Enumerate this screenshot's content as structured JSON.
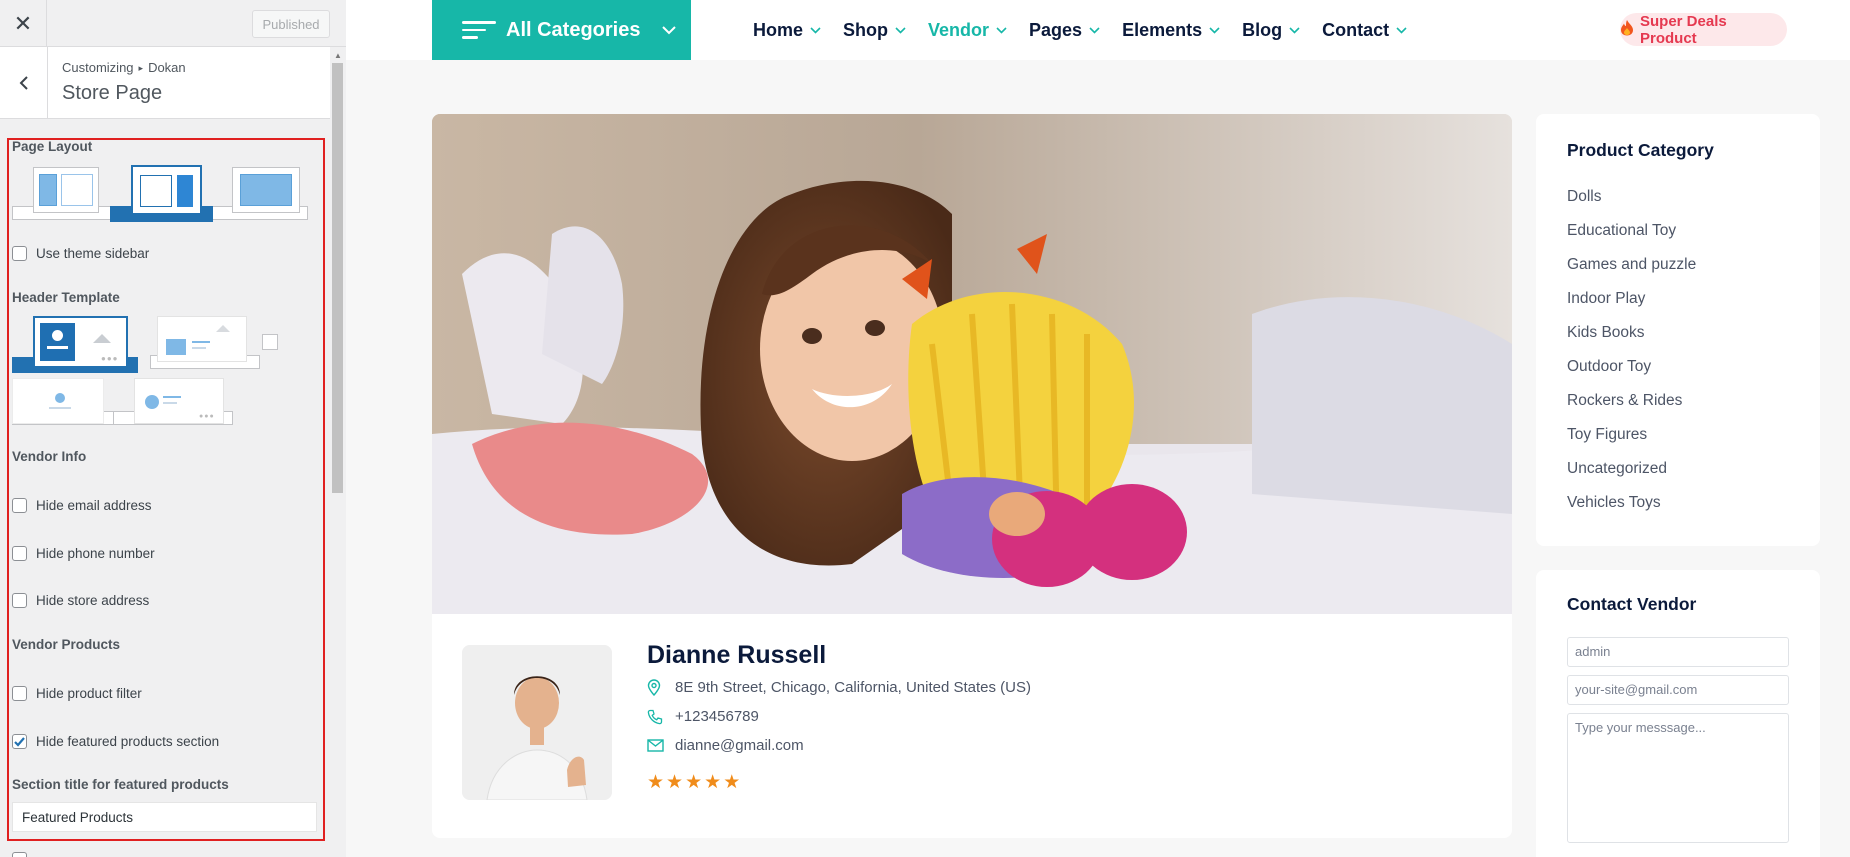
{
  "customizer": {
    "publish_label": "Published",
    "breadcrumb": [
      "Customizing",
      "Dokan"
    ],
    "breadcrumb_sep": "▸",
    "title": "Store Page",
    "page_layout_label": "Page Layout",
    "page_layout_selected": "right-sidebar",
    "use_theme_sidebar_label": "Use theme sidebar",
    "use_theme_sidebar": false,
    "header_template_label": "Header Template",
    "header_template_selected": "default",
    "vendor_info_label": "Vendor Info",
    "hide_email_label": "Hide email address",
    "hide_phone_label": "Hide phone number",
    "hide_address_label": "Hide store address",
    "vendor_products_label": "Vendor Products",
    "hide_filter_label": "Hide product filter",
    "hide_featured_label": "Hide featured products section",
    "hide_featured_checked": true,
    "featured_title_label": "Section title for featured products",
    "featured_title_value": "Featured Products",
    "highlight_color": "#e02020"
  },
  "site": {
    "all_categories": "All Categories",
    "nav": [
      "Home",
      "Shop",
      "Vendor",
      "Pages",
      "Elements",
      "Blog",
      "Contact"
    ],
    "nav_active": "Vendor",
    "deals": "Super Deals Product",
    "accent_color": "#17b7a8"
  },
  "vendor": {
    "name": "Dianne Russell",
    "address": "8E 9th Street, Chicago, California, United States (US)",
    "phone": "+123456789",
    "email": "dianne@gmail.com",
    "rating": 5
  },
  "product_category": {
    "title": "Product Category",
    "items": [
      "Dolls",
      "Educational Toy",
      "Games and puzzle",
      "Indoor Play",
      "Kids Books",
      "Outdoor Toy",
      "Rockers & Rides",
      "Toy Figures",
      "Uncategorized",
      "Vehicles Toys"
    ]
  },
  "contact_vendor": {
    "title": "Contact Vendor",
    "name_placeholder": "admin",
    "email_placeholder": "your-site@gmail.com",
    "message_placeholder": "Type your messsage..."
  }
}
